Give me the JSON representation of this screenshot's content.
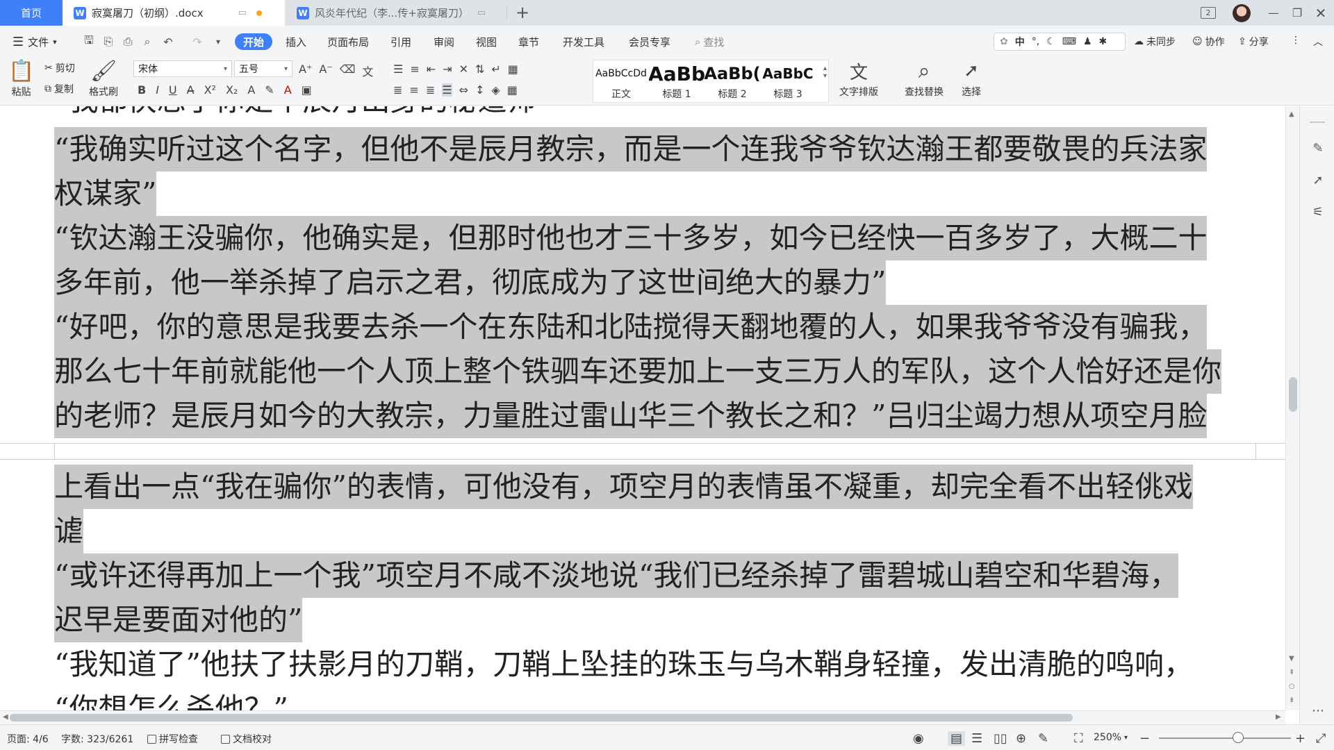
{
  "tabs": {
    "home": "首页",
    "doc1": {
      "title": "寂寞屠刀（初纲）.docx",
      "icon": "W"
    },
    "doc2": {
      "title": "风炎年代纪（李...传+寂寞屠刀）",
      "icon": "W"
    },
    "add": "+"
  },
  "menu": {
    "file": "文件",
    "items": [
      "开始",
      "插入",
      "页面布局",
      "引用",
      "审阅",
      "视图",
      "章节",
      "开发工具",
      "会员专享"
    ],
    "search": "查找",
    "ime_label": "中",
    "sync": "未同步",
    "collab": "协作",
    "share": "分享"
  },
  "ribbon": {
    "paste": "粘贴",
    "cut": "剪切",
    "copy": "复制",
    "format_painter": "格式刷",
    "font_name": "宋体",
    "font_size": "五号",
    "styles": [
      {
        "sample": "AaBbCcDd",
        "name": "正文"
      },
      {
        "sample": "AaBb",
        "name": "标题 1"
      },
      {
        "sample": "AaBb(",
        "name": "标题 2"
      },
      {
        "sample": "AaBbC",
        "name": "标题 3"
      }
    ],
    "text_layout": "文字排版",
    "find_replace": "查找替换",
    "select": "选择"
  },
  "document": {
    "lines": [
      {
        "text": "“我确实听过这个名字，但他不是辰月教宗，而是一个连我爷爷钦达瀚王都要敬畏的兵法家",
        "highlight": true
      },
      {
        "text": "权谋家”",
        "highlight": true
      },
      {
        "text": "“钦达瀚王没骗你，他确实是，但那时他也才三十多岁，如今已经快一百多岁了，大概二十",
        "highlight": true
      },
      {
        "text": "多年前，他一举杀掉了启示之君，彻底成为了这世间绝大的暴力”",
        "highlight": true
      },
      {
        "text": "“好吧，你的意思是我要去杀一个在东陆和北陆搅得天翻地覆的人，如果我爷爷没有骗我，",
        "highlight": true
      },
      {
        "text": "那么七十年前就能他一个人顶上整个铁驷车还要加上一支三万人的军队，这个人恰好还是你",
        "highlight": true
      },
      {
        "text": "的老师？是辰月如今的大教宗，力量胜过雷山华三个教长之和？”吕归尘竭力想从项空月脸",
        "highlight": true
      },
      {
        "text": "上看出一点“我在骗你”的表情，可他没有，项空月的表情虽不凝重，却完全看不出轻佻戏",
        "highlight": true
      },
      {
        "text": "谑",
        "highlight": true
      },
      {
        "text": "“或许还得再加上一个我”项空月不咸不淡地说“我们已经杀掉了雷碧城山碧空和华碧海，",
        "highlight": true
      },
      {
        "text": "迟早是要面对他的”",
        "highlight": true
      },
      {
        "text": "“我知道了”他扶了扶影月的刀鞘，刀鞘上坠挂的珠玉与乌木鞘身轻撞，发出清脆的鸣响，",
        "highlight": false
      }
    ]
  },
  "status": {
    "page": "页面: 4/6",
    "words": "字数: 323/6261",
    "spell": "拼写检查",
    "proof": "文档校对",
    "zoom": "250%"
  },
  "colors": {
    "accent": "#3e7ffa",
    "highlight": "#c8c8c8",
    "modified_dot": "#f5a623"
  }
}
